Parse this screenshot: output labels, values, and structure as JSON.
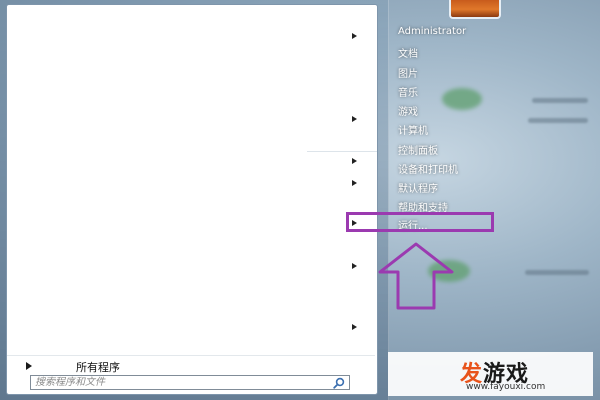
{
  "start_menu": {
    "left_pane": {
      "all_programs_label": "所有程序",
      "search_placeholder": "搜索程序和文件"
    },
    "right_pane": {
      "items": [
        {
          "label": "Administrator"
        },
        {
          "label": "文档"
        },
        {
          "label": "图片"
        },
        {
          "label": "音乐"
        },
        {
          "label": "游戏"
        },
        {
          "label": "计算机"
        },
        {
          "label": "控制面板"
        },
        {
          "label": "设备和打印机"
        },
        {
          "label": "默认程序"
        },
        {
          "label": "帮助和支持"
        },
        {
          "label": "运行..."
        }
      ]
    }
  },
  "annotation": {
    "highlight_color": "#9b3ab0",
    "highlighted_item": "运行..."
  },
  "watermark": {
    "logo_part1": "发",
    "logo_part2": "游戏",
    "url": "www.fayouxi.com",
    "colors": {
      "part1": "#e8531b",
      "part2": "#1a1a1a"
    }
  }
}
